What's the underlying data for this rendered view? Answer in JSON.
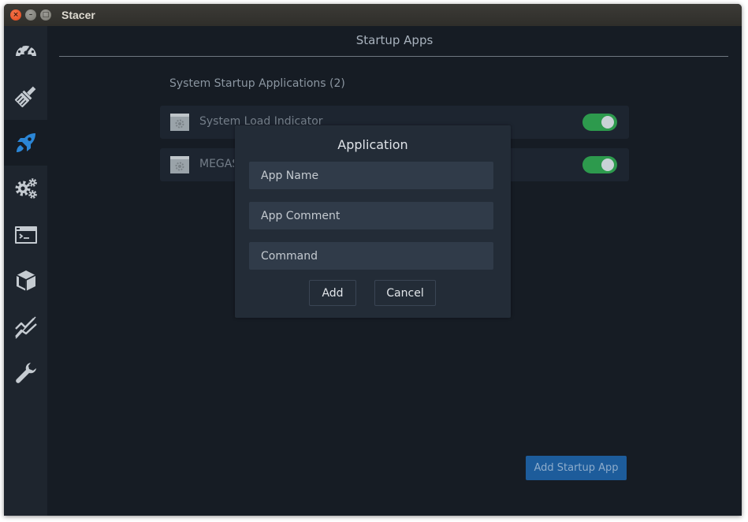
{
  "window": {
    "title": "Stacer",
    "controls": {
      "close": "×",
      "minimize": "–",
      "maximize": "□"
    }
  },
  "sidebar": {
    "items": [
      {
        "icon": "dashboard-gauge-icon"
      },
      {
        "icon": "system-cleaner-broom-icon"
      },
      {
        "icon": "startup-apps-rocket-icon",
        "active": true
      },
      {
        "icon": "services-gears-icon"
      },
      {
        "icon": "processes-terminal-icon"
      },
      {
        "icon": "uninstaller-package-icon"
      },
      {
        "icon": "resources-chart-icon"
      },
      {
        "icon": "settings-wrench-icon"
      }
    ]
  },
  "page": {
    "title": "Startup Apps",
    "section_title": "System Startup Applications (2)",
    "apps": [
      {
        "name": "System Load Indicator",
        "enabled": true
      },
      {
        "name": "MEGASync",
        "enabled": true
      }
    ],
    "add_button_label": "Add Startup App"
  },
  "dialog": {
    "title": "Application",
    "fields": {
      "app_name_placeholder": "App Name",
      "app_comment_placeholder": "App Comment",
      "command_placeholder": "Command"
    },
    "add_label": "Add",
    "cancel_label": "Cancel"
  },
  "colors": {
    "background": "#161c24",
    "sidebar": "#1e252e",
    "accent_blue": "#1d5c9b",
    "toggle_on": "#2d9a4d",
    "dialog": "#232c37"
  }
}
